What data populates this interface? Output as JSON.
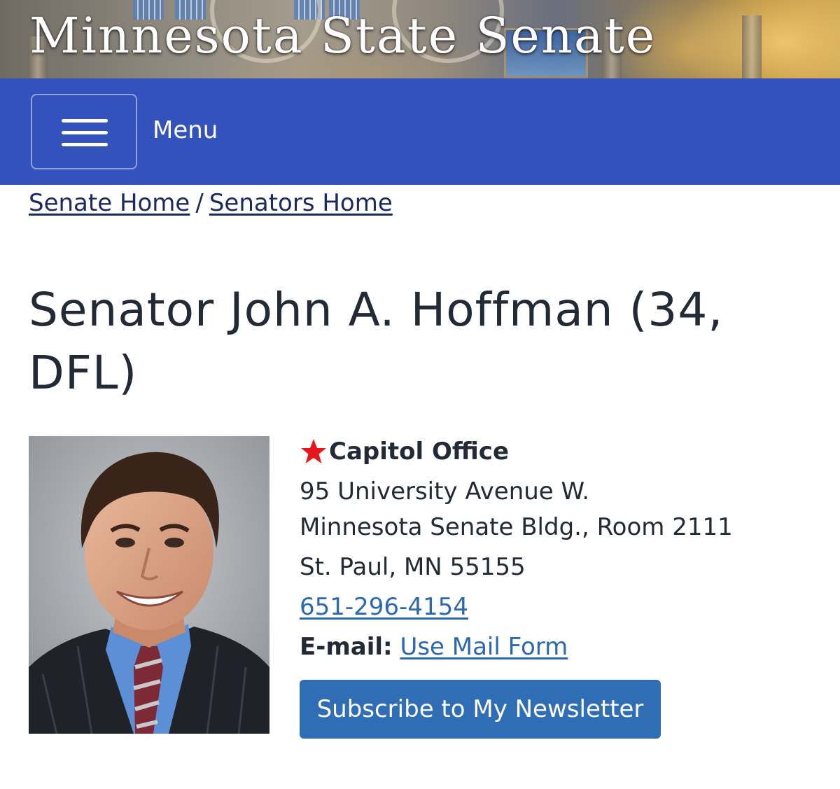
{
  "banner": {
    "site_title": "Minnesota State Senate"
  },
  "navbar": {
    "menu_label": "Menu"
  },
  "breadcrumb": {
    "items": [
      "Senate Home",
      "Senators Home"
    ],
    "separator": "/"
  },
  "page": {
    "title": "Senator John A. Hoffman (34, DFL)"
  },
  "office": {
    "heading": "Capitol Office",
    "address_lines": [
      "95 University Avenue W.",
      "Minnesota Senate Bldg., Room 2111",
      "St. Paul, MN 55155"
    ],
    "phone": "651-296-4154",
    "email_label": "E-mail:",
    "email_link": "Use Mail Form",
    "star_color": "#e8151b"
  },
  "newsletter_button": "Subscribe to My Newsletter",
  "colors": {
    "navbar": "#3452bc",
    "button": "#2f6db5",
    "link": "#2c67b1",
    "breadcrumb": "#1b2a5e"
  }
}
